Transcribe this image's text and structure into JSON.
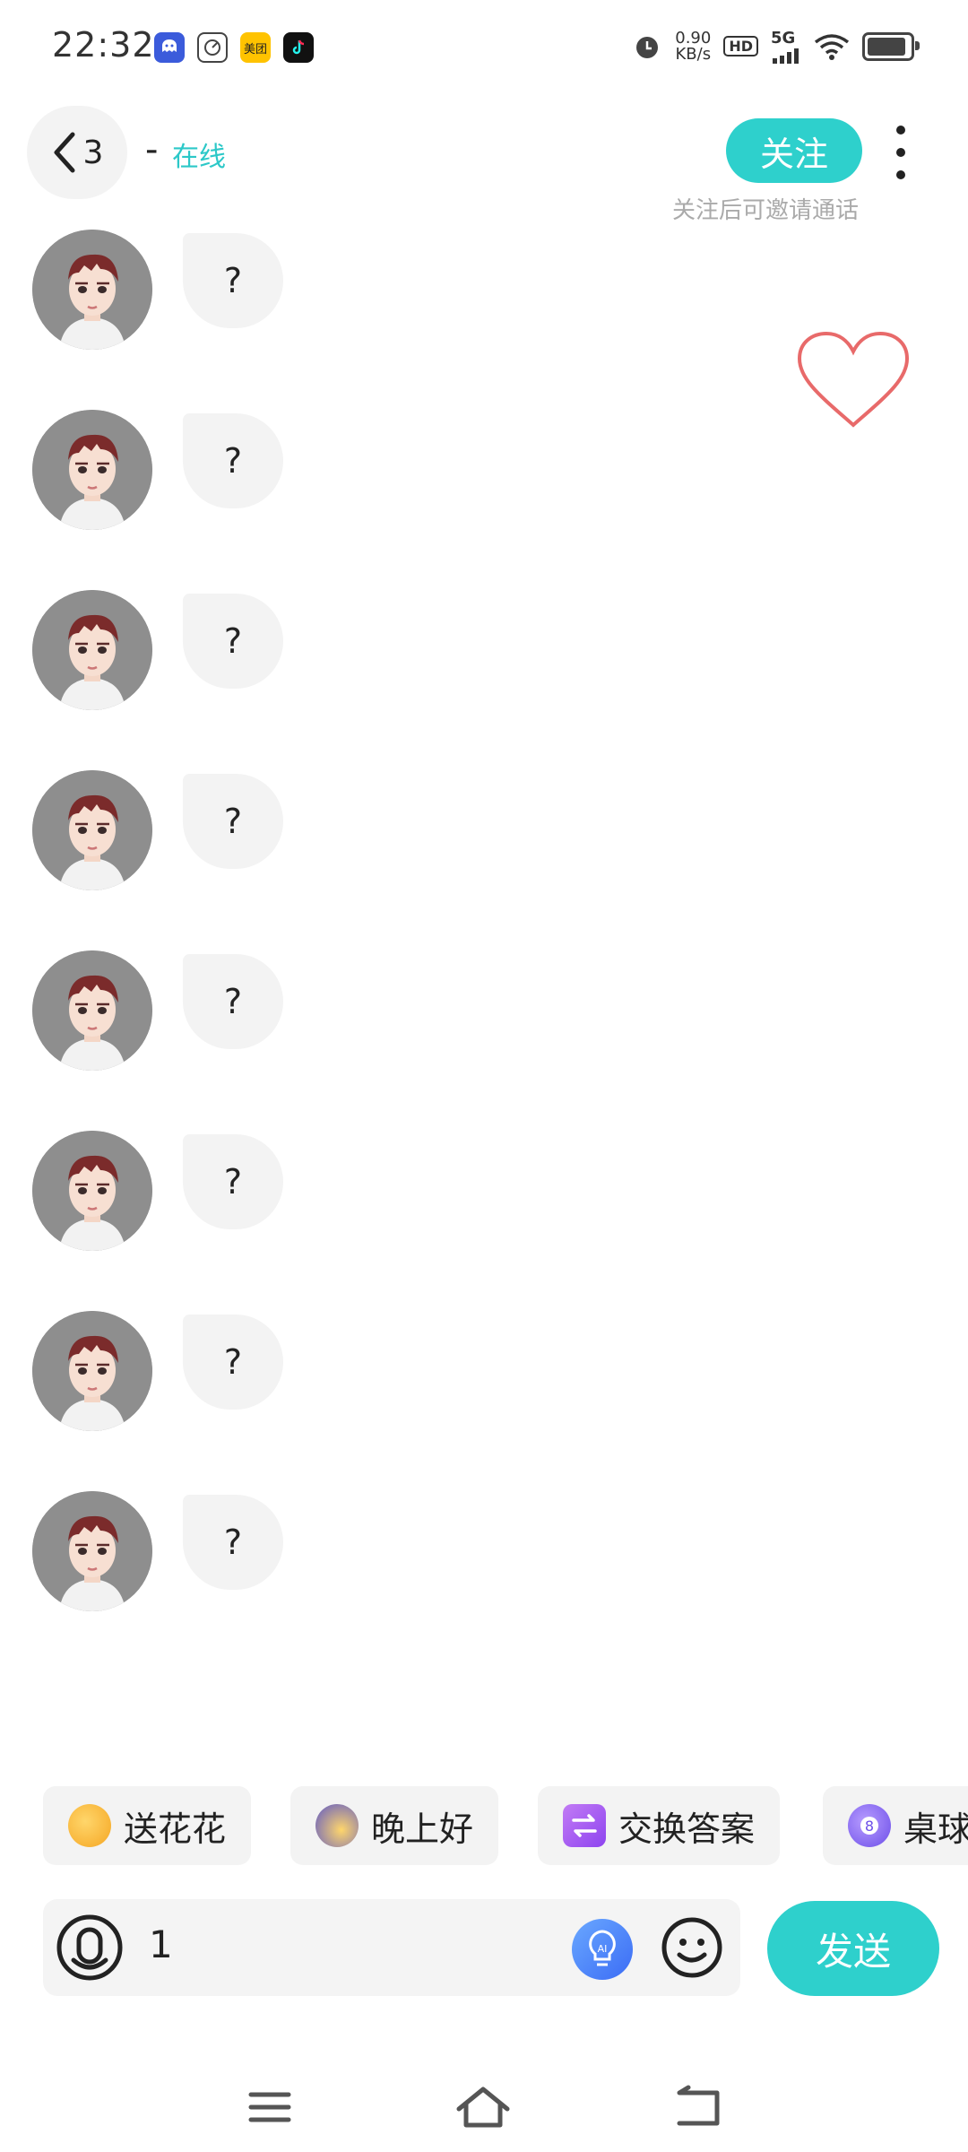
{
  "status_bar": {
    "time": "22:32",
    "net_speed_value": "0.90",
    "net_speed_unit": "KB/s",
    "hd_label": "HD",
    "network_label": "5G",
    "app_icons": [
      "chat-app-icon",
      "speed-app-icon",
      "meituan-icon",
      "tiktok-icon"
    ],
    "meituan_label": "美团"
  },
  "header": {
    "back_count": "3",
    "dash": "-",
    "online_status": "在线",
    "follow_label": "关注",
    "follow_hint": "关注后可邀请通话"
  },
  "messages": [
    {
      "text": "?"
    },
    {
      "text": "?"
    },
    {
      "text": "?"
    },
    {
      "text": "?"
    },
    {
      "text": "?"
    },
    {
      "text": "?"
    },
    {
      "text": "?"
    },
    {
      "text": "?"
    }
  ],
  "quick_replies": [
    {
      "label": "送花花",
      "icon": "flower-emoji-icon"
    },
    {
      "label": "晚上好",
      "icon": "moon-emoji-icon"
    },
    {
      "label": "交换答案",
      "icon": "exchange-icon"
    },
    {
      "label": "桌球",
      "icon": "billiard-ball-icon"
    }
  ],
  "input": {
    "value": "1",
    "send_label": "发送"
  },
  "colors": {
    "accent": "#2ed0cc",
    "online_text": "#2cc8c8",
    "heart_stroke": "#e86a6a",
    "hint_text": "#aaaaaa"
  }
}
